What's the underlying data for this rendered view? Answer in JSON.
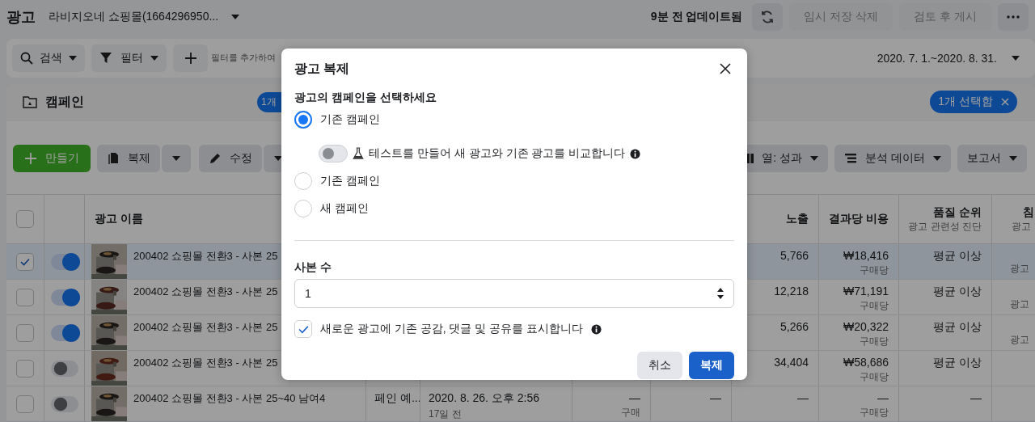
{
  "header": {
    "title": "광고",
    "account": "라비지오네 쇼핑몰(1664296950...",
    "updated": "9분 전 업데이트됨",
    "buttons": [
      {
        "label": "임시 저장 삭제",
        "disabled": true
      },
      {
        "label": "검토 후 게시",
        "disabled": true
      }
    ]
  },
  "filter_bar": {
    "search": "검색",
    "filter": "필터",
    "placeholder": "필터를 추가하여",
    "date_range": "2020. 7. 1.~2020. 8. 31."
  },
  "campaign_bar": {
    "label": "캠페인",
    "count_badge": "1개",
    "selection": "1개 선택함"
  },
  "toolbar": {
    "create": "만들기",
    "duplicate": "복제",
    "edit": "수정",
    "columns": "열: 성과",
    "breakdown": "분석 데이터",
    "reports": "보고서"
  },
  "table": {
    "all_selected": false,
    "columns": [
      {
        "label": "광고 이름"
      },
      {
        "label": "노출"
      },
      {
        "label": "결과당 비용"
      },
      {
        "label": "품질 순위",
        "sub": "광고 관련성 진단"
      },
      {
        "label": "침",
        "sub": "광고"
      }
    ],
    "rows": [
      {
        "selected": true,
        "on": true,
        "name": "200402 쇼핑몰 전환3 - 사본 25",
        "impressions": "5,766",
        "cost": "₩18,416",
        "cost_unit": "구매당",
        "quality": "평균 이상",
        "column_last": "광고"
      },
      {
        "selected": false,
        "on": true,
        "name": "200402 쇼핑몰 전환3 - 사본 25",
        "impressions": "12,218",
        "cost": "₩71,191",
        "cost_unit": "구매당",
        "quality": "평균 이상",
        "column_last": "광고"
      },
      {
        "selected": false,
        "on": true,
        "name": "200402 쇼핑몰 전환3 - 사본 25",
        "impressions": "5,266",
        "cost": "₩20,322",
        "cost_unit": "구매당",
        "quality": "평균 이상",
        "column_last": "광고"
      },
      {
        "selected": false,
        "on": false,
        "name": "200402 쇼핑몰 전환3 - 사본 25",
        "impressions": "34,404",
        "cost": "₩58,686",
        "cost_unit": "구매당",
        "quality": "평균 이상"
      },
      {
        "selected": false,
        "on": false,
        "name": "200402 쇼핑몰 전환3 - 사본 25~40 남여4",
        "campaign": "페인 예...",
        "date": "2020. 8. 26. 오후 2:56",
        "date_sub": "17일 전",
        "results": "—",
        "results_unit": "구매",
        "reach": "—",
        "impressions": "—",
        "cost": "—",
        "cost_unit": "구매당",
        "quality": "—"
      }
    ]
  },
  "dialog": {
    "title": "광고 복제",
    "question": "광고의 캠페인을 선택하세요",
    "options": [
      {
        "label": "기존 캠페인",
        "selected": true,
        "test_toggle": {
          "label": "테스트를 만들어 새 광고와 기존 광고를 비교합니다",
          "on": false
        }
      },
      {
        "label": "기존 캠페인",
        "selected": false
      },
      {
        "label": "새 캠페인",
        "selected": false
      }
    ],
    "copies_label": "사본 수",
    "copies_value": "1",
    "show_engagement": {
      "label": "새로운 광고에 기존 공감, 댓글 및 공유를 표시합니다",
      "checked": true
    },
    "buttons": [
      {
        "label": "취소",
        "kind": "secondary"
      },
      {
        "label": "복제",
        "kind": "primary"
      }
    ]
  }
}
